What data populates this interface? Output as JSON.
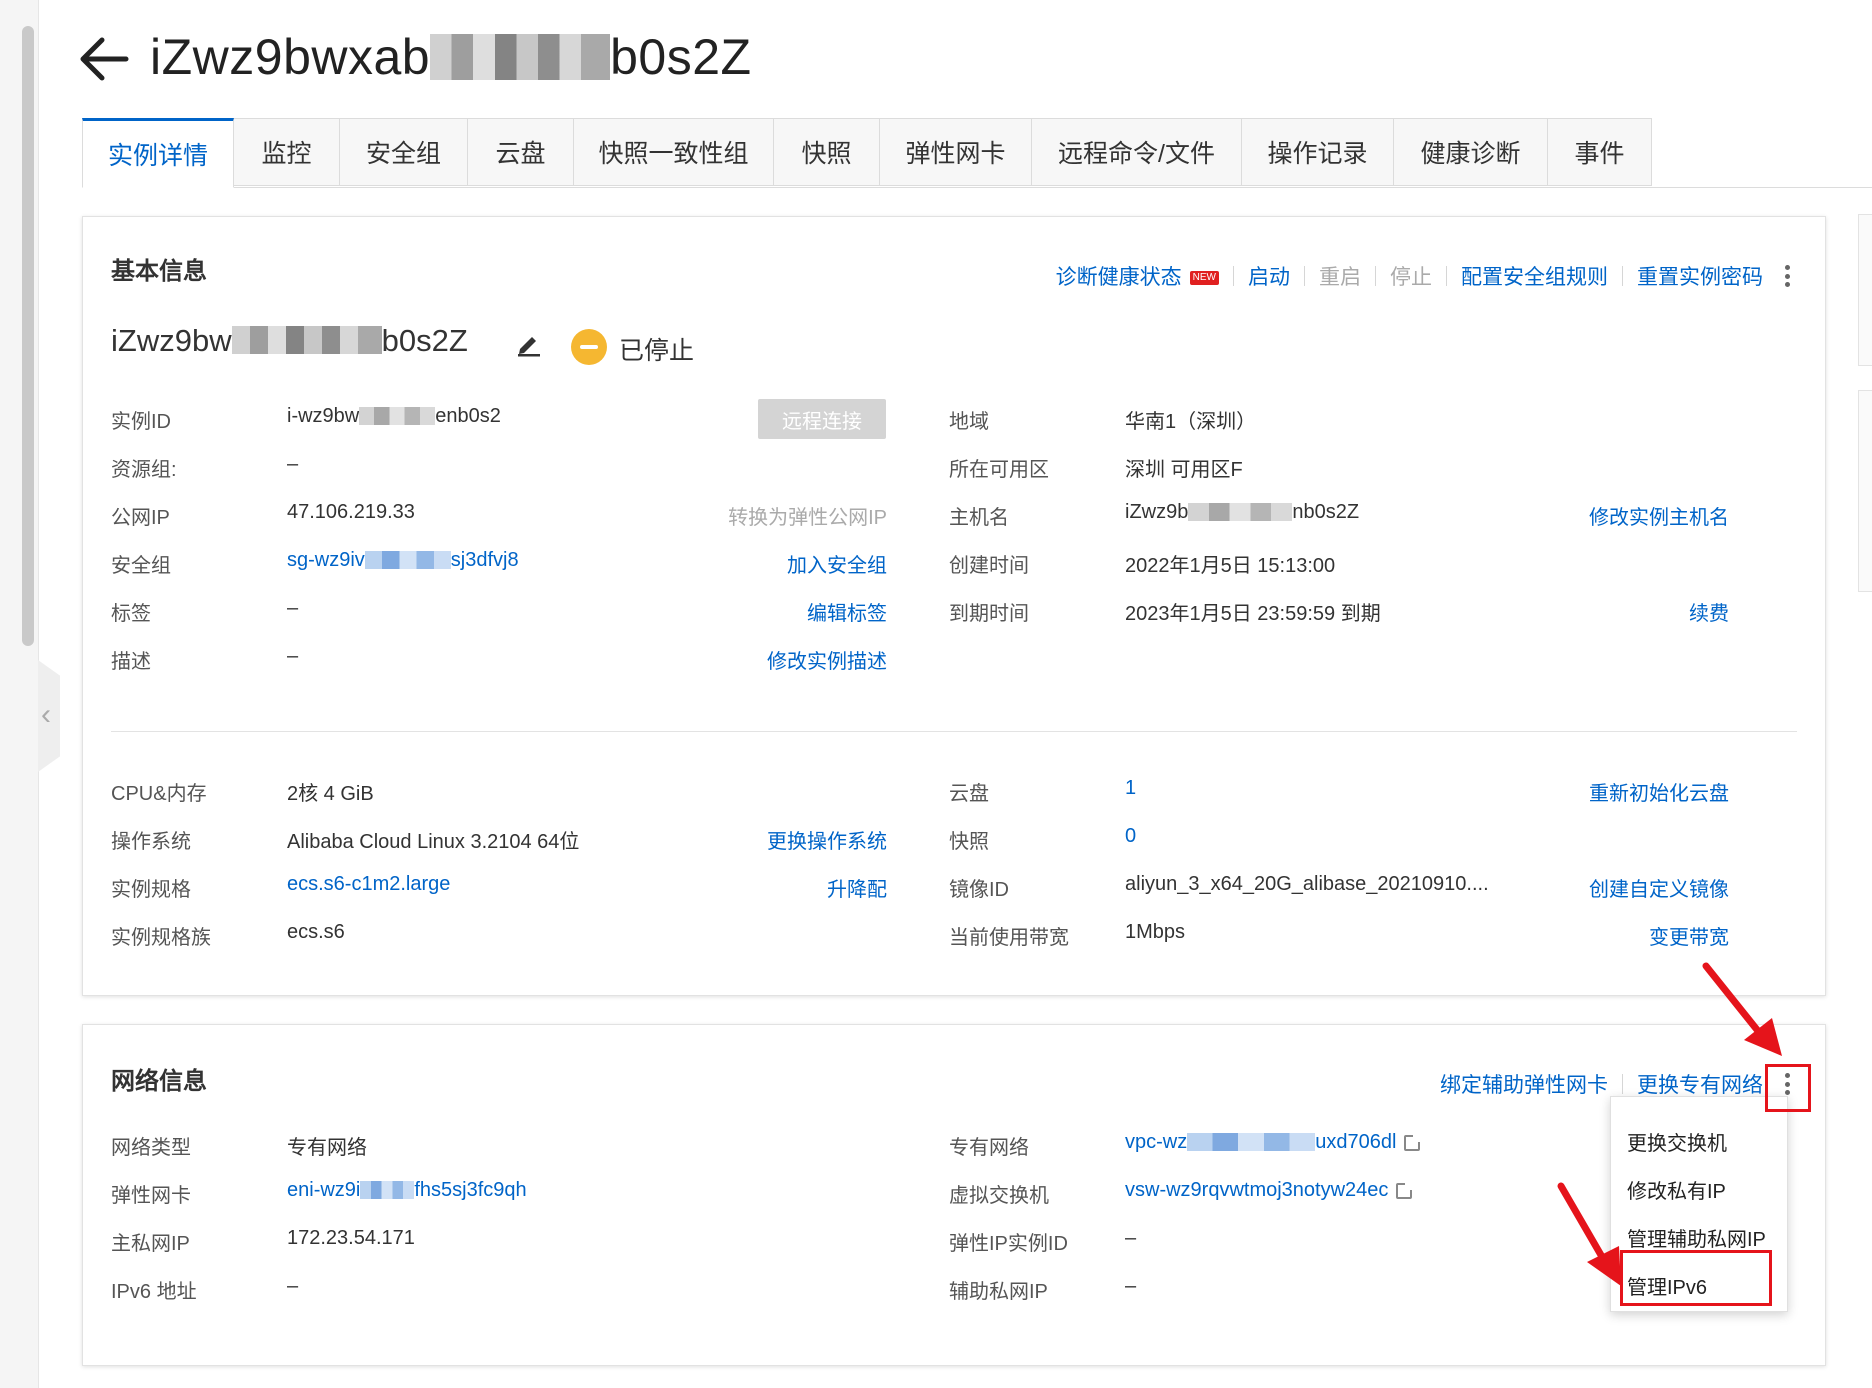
{
  "header": {
    "title_prefix": "iZwz9bwxab",
    "title_suffix": "b0s2Z"
  },
  "tabs": [
    {
      "label": "实例详情",
      "active": true
    },
    {
      "label": "监控"
    },
    {
      "label": "安全组"
    },
    {
      "label": "云盘"
    },
    {
      "label": "快照一致性组"
    },
    {
      "label": "快照"
    },
    {
      "label": "弹性网卡"
    },
    {
      "label": "远程命令/文件"
    },
    {
      "label": "操作记录"
    },
    {
      "label": "健康诊断"
    },
    {
      "label": "事件"
    }
  ],
  "basic": {
    "title": "基本信息",
    "actions": {
      "diagnose": "诊断健康状态",
      "new_badge": "NEW",
      "start": "启动",
      "restart": "重启",
      "stop": "停止",
      "config_rules": "配置安全组规则",
      "reset_password": "重置实例密码"
    },
    "instance_name_prefix": "iZwz9bw",
    "instance_name_suffix": "b0s2Z",
    "status": "已停止",
    "remote_connect": "远程连接",
    "left": {
      "instance_id": {
        "label": "实例ID",
        "prefix": "i-wz9bw",
        "suffix": "enb0s2"
      },
      "resource_group": {
        "label": "资源组:",
        "value": "–"
      },
      "public_ip": {
        "label": "公网IP",
        "value": "47.106.219.33",
        "action": "转换为弹性公网IP"
      },
      "security_group": {
        "label": "安全组",
        "prefix": "sg-wz9iv",
        "suffix": "sj3dfvj8",
        "action": "加入安全组"
      },
      "tags": {
        "label": "标签",
        "value": "–",
        "action": "编辑标签"
      },
      "description": {
        "label": "描述",
        "value": "–",
        "action": "修改实例描述"
      }
    },
    "right": {
      "region": {
        "label": "地域",
        "value": "华南1（深圳）"
      },
      "zone": {
        "label": "所在可用区",
        "value": "深圳 可用区F"
      },
      "hostname": {
        "label": "主机名",
        "prefix": "iZwz9b",
        "suffix": "nb0s2Z",
        "action": "修改实例主机名"
      },
      "created": {
        "label": "创建时间",
        "value": "2022年1月5日 15:13:00"
      },
      "expires": {
        "label": "到期时间",
        "value": "2023年1月5日 23:59:59 到期",
        "action": "续费"
      }
    },
    "spec_left": {
      "cpu_mem": {
        "label": "CPU&内存",
        "value": "2核 4 GiB"
      },
      "os": {
        "label": "操作系统",
        "value": "Alibaba Cloud Linux 3.2104 64位",
        "action": "更换操作系统"
      },
      "spec": {
        "label": "实例规格",
        "value": "ecs.s6-c1m2.large",
        "action": "升降配"
      },
      "family": {
        "label": "实例规格族",
        "value": "ecs.s6"
      }
    },
    "spec_right": {
      "disk": {
        "label": "云盘",
        "value": "1",
        "action": "重新初始化云盘"
      },
      "snapshot": {
        "label": "快照",
        "value": "0"
      },
      "image": {
        "label": "镜像ID",
        "value": "aliyun_3_x64_20G_alibase_20210910....",
        "action": "创建自定义镜像"
      },
      "bandwidth": {
        "label": "当前使用带宽",
        "value": "1Mbps",
        "action": "变更带宽"
      }
    }
  },
  "network": {
    "title": "网络信息",
    "actions": {
      "bind_eni": "绑定辅助弹性网卡",
      "change_vpc": "更换专有网络"
    },
    "left": {
      "type": {
        "label": "网络类型",
        "value": "专有网络"
      },
      "eni": {
        "label": "弹性网卡",
        "prefix": "eni-wz9i",
        "suffix": "fhs5sj3fc9qh"
      },
      "private_ip": {
        "label": "主私网IP",
        "value": "172.23.54.171"
      },
      "ipv6": {
        "label": "IPv6 地址",
        "value": "–"
      }
    },
    "right": {
      "vpc": {
        "label": "专有网络",
        "prefix": "vpc-wz",
        "suffix": "uxd706dl"
      },
      "vswitch": {
        "label": "虚拟交换机",
        "value": "vsw-wz9rqvwtmoj3notyw24ec"
      },
      "eip_id": {
        "label": "弹性IP实例ID",
        "value": "–"
      },
      "secondary_ip": {
        "label": "辅助私网IP",
        "value": "–"
      }
    },
    "dropdown": [
      "更换交换机",
      "修改私有IP",
      "管理辅助私网IP",
      "管理IPv6"
    ]
  },
  "colors": {
    "link": "#0064c8",
    "status": "#f5b731",
    "annotation": "#e5141b"
  }
}
